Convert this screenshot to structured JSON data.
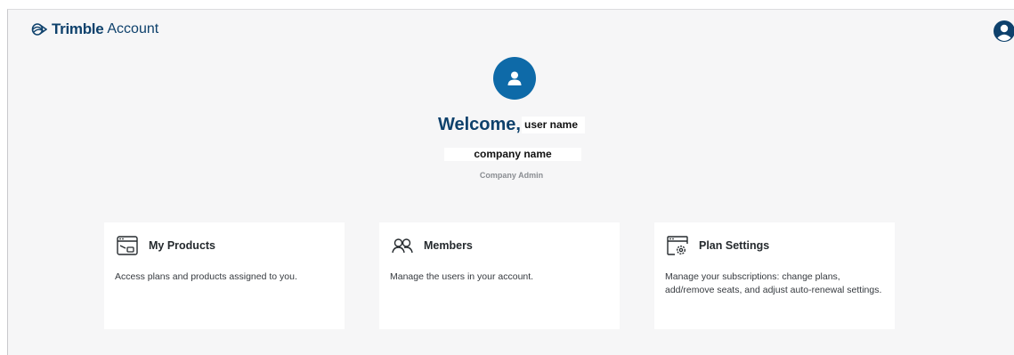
{
  "header": {
    "brand_name": "Trimble",
    "brand_product": "Account",
    "user_menu_icon": "user-circle-icon"
  },
  "hero": {
    "avatar_icon": "person-icon",
    "welcome_text": "Welcome,",
    "user_name": "user name",
    "company_name": "company name",
    "role": "Company Admin"
  },
  "cards": [
    {
      "icon": "browser-window-icon",
      "title": "My Products",
      "description": "Access plans and products assigned to you."
    },
    {
      "icon": "users-icon",
      "title": "Members",
      "description": "Manage the users in your account."
    },
    {
      "icon": "settings-window-icon",
      "title": "Plan Settings",
      "description": "Manage your subscriptions: change plans, add/remove seats, and adjust auto-renewal settings."
    }
  ],
  "colors": {
    "brand": "#0e416c",
    "accent": "#0e6aa8",
    "background": "#f6f6f7",
    "card": "#ffffff"
  }
}
